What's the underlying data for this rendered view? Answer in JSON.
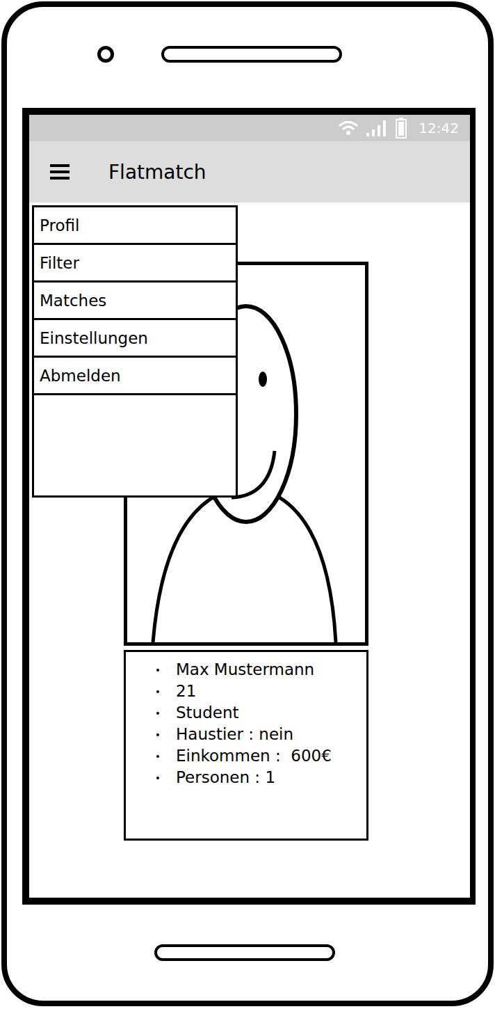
{
  "status_bar": {
    "time": "12:42"
  },
  "app_bar": {
    "title": "Flatmatch"
  },
  "menu": {
    "open": true,
    "items": [
      {
        "label": "Profil"
      },
      {
        "label": "Filter"
      },
      {
        "label": "Matches"
      },
      {
        "label": "Einstellungen"
      },
      {
        "label": "Abmelden"
      }
    ]
  },
  "profile": {
    "fields": [
      "Max Mustermann",
      "21",
      "Student",
      "Haustier : nein",
      "Einkommen :  600€",
      "Personen : 1"
    ]
  }
}
